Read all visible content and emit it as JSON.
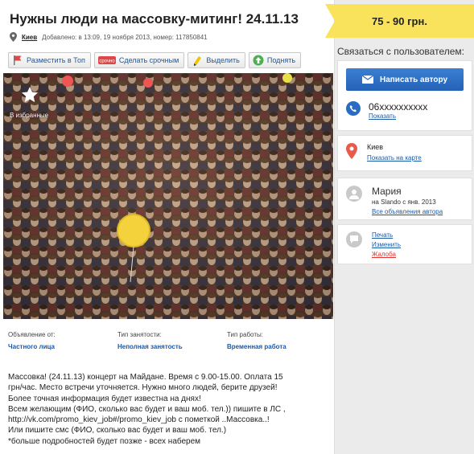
{
  "ad": {
    "title": "Нужны люди на массовку-митинг! 24.11.13",
    "city": "Киев",
    "posted": "Добавлено: в 13:09, 19 ноября 2013, номер: 117850841",
    "favorite_label": "В избранные"
  },
  "actions": [
    {
      "label": "Разместить в Топ",
      "icon": "flag-icon"
    },
    {
      "label": "Сделать срочным",
      "icon": "urgent-icon",
      "badge": "срочно"
    },
    {
      "label": "Выделить",
      "icon": "highlighter-icon"
    },
    {
      "label": "Поднять",
      "icon": "arrow-up-icon"
    }
  ],
  "fields": [
    {
      "label": "Объявление от:",
      "value": "Частного лица"
    },
    {
      "label": "Тип занятости:",
      "value": "Неполная занятость"
    },
    {
      "label": "Тип работы:",
      "value": "Временная работа"
    }
  ],
  "description": "Массовка! (24.11.13) концерт на Майдане. Время с 9.00-15.00. Оплата 15\nгрн/час. Место встречи уточняется. Нужно много людей, берите друзей!\nБолее точная информация будет известна на днях!\nВсем желающим (ФИО, сколько вас будет и ваш моб. тел.)) пишите в ЛС ,\nhttp://vk.com/promo_kiev_job#/promo_kiev_job с пометкой ..Массовка..!\nИли пишите смс (ФИО, сколько вас будет и ваш моб. тел.)\n*больше подробностей будет позже - всех наберем",
  "sidebar": {
    "price": "75 - 90 грн.",
    "contact_title": "Связаться с пользователем:",
    "write_button": "Написать автору",
    "phone": "06xxxxxxxxxx",
    "phone_show": "Показать",
    "location_city": "Киев",
    "show_on_map": "Показать на карте",
    "user_name": "Мария",
    "user_since": "на Slando с янв. 2013",
    "user_all_ads": "Все объявления автора",
    "print": "Печать",
    "edit": "Изменить",
    "complaint": "Жалоба"
  },
  "colors": {
    "link": "#1a5aa6",
    "price_bg": "#f9e35c",
    "button": "#2a6cc2",
    "complaint": "#dd3333"
  }
}
